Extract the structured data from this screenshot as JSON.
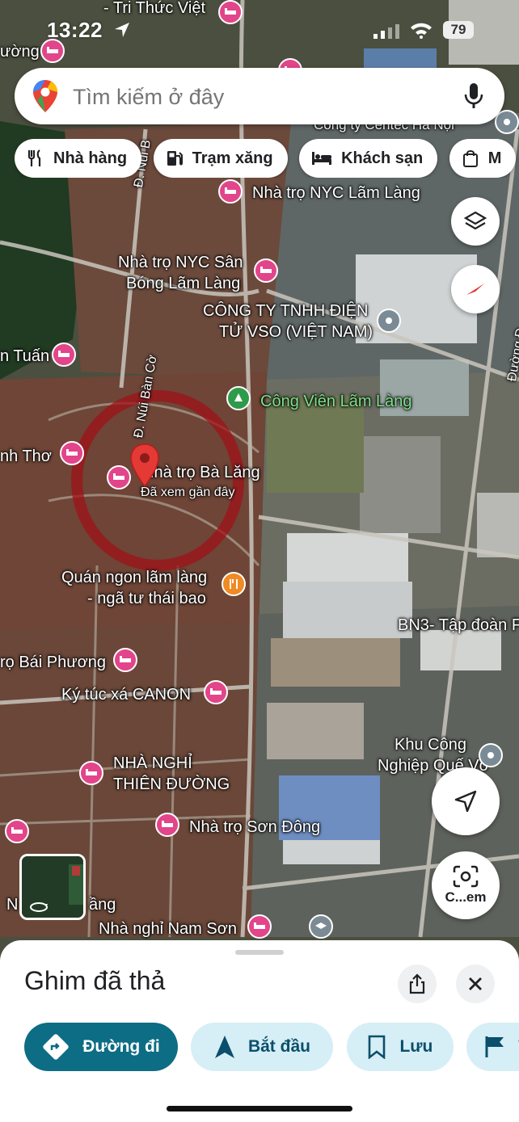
{
  "status_bar": {
    "time": "13:22",
    "battery": "79"
  },
  "search": {
    "placeholder": "Tìm kiếm ở đây"
  },
  "chips": [
    {
      "label": "Nhà hàng",
      "icon": "restaurant-icon"
    },
    {
      "label": "Trạm xăng",
      "icon": "gas-station-icon"
    },
    {
      "label": "Khách sạn",
      "icon": "hotel-icon"
    },
    {
      "label": "M",
      "icon": "shopping-bag-icon"
    }
  ],
  "map": {
    "labels": {
      "tri_thuc": "- Tri Thức Việt",
      "duong": "ường",
      "nyc": "Nhà trọ NYC Lãm Làng",
      "nyc_san_1": "Nhà trọ NYC Sân",
      "nyc_san_2": "Bóng Lãm Làng",
      "vso_1": "CÔNG TY TNHH ĐIỆN",
      "vso_2": "TỬ VSO (VIỆT NAM)",
      "tuan": "n Tuấn",
      "park": "Công Viên Lãm Làng",
      "nh_tho": "nh Thơ",
      "ba_lang": "Nhà trọ Bà Lăng",
      "recent": "Đã xem gần đây",
      "quan_1": "Quán ngon lãm làng",
      "quan_2": "- ngã tư thái bao",
      "bn3": "BN3- Tập đoàn F",
      "bai_phuong": "rọ Bái Phương",
      "canon": "Ký túc xá CANON",
      "kcn_1": "Khu Công",
      "kcn_2": "Nghiệp Quế Võ",
      "thien_1": "NHÀ NGHỈ",
      "thien_2": "THIÊN ĐƯỜNG",
      "son_dong": "Nhà trọ Sơn Đông",
      "tang": "N",
      "tang2": "ầng",
      "nam_son": "Nhà nghỉ Nam Sơn",
      "road_nui_ban_co": "Đ. Núi Bàn Cờ",
      "road_nui_b": "Đ. Núi B",
      "road_duong": "Đường Đ",
      "centec": "Công ty Centec Hà Nội"
    },
    "camera_label": "C...em"
  },
  "sheet": {
    "title": "Ghim đã thả",
    "actions": [
      {
        "label": "Đường đi"
      },
      {
        "label": "Bắt đầu"
      },
      {
        "label": "Lưu"
      },
      {
        "label": "T"
      }
    ]
  },
  "colors": {
    "primary": "#0c6d84",
    "secondary": "#d6eef6",
    "poi": "#e2458a",
    "pin": "#e53935"
  }
}
